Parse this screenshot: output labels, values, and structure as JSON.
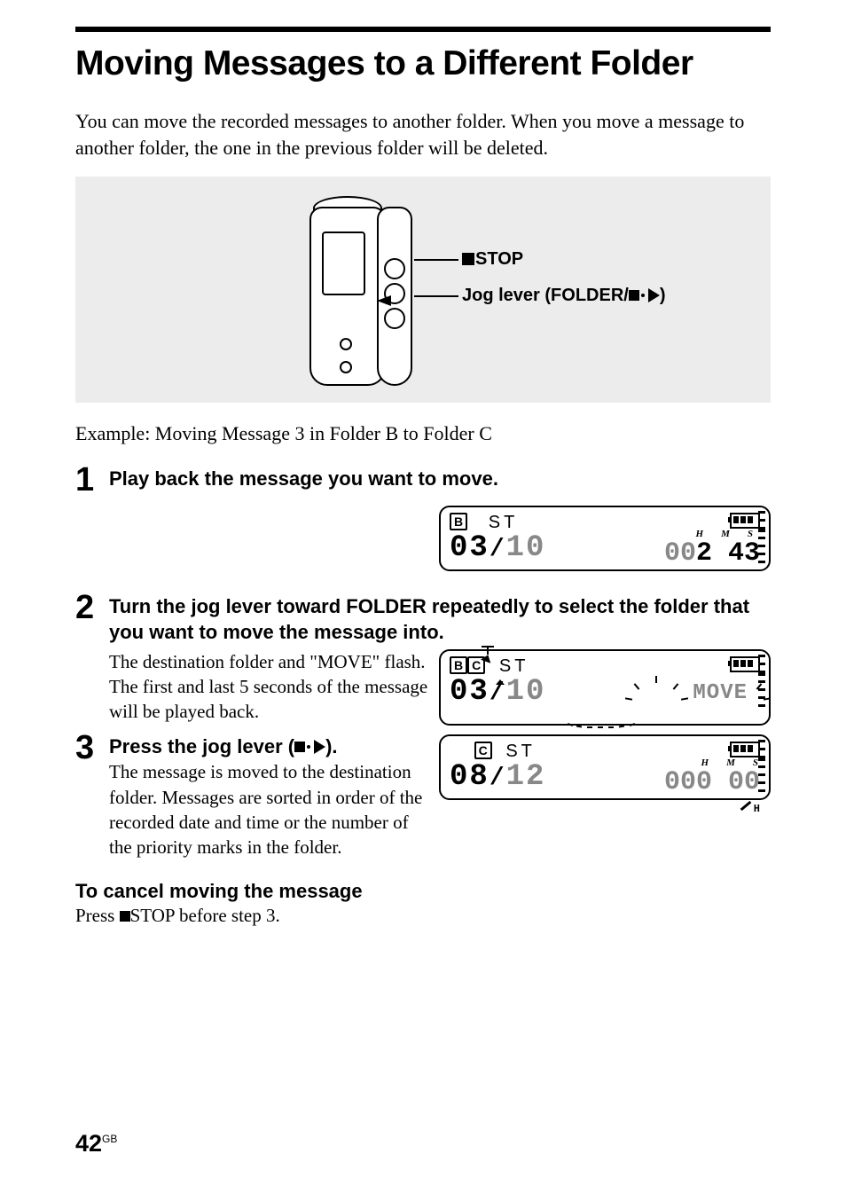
{
  "title": "Moving Messages to a Different Folder",
  "intro": "You can move the recorded messages to another folder. When you move a message to another folder, the one in the previous folder will be deleted.",
  "callouts": {
    "stop": "STOP",
    "jog": "Jog lever (FOLDER/"
  },
  "example": "Example: Moving Message 3 in Folder B to Folder C",
  "steps": {
    "s1_num": "1",
    "s1_head": "Play back the message you want to move.",
    "s2_num": "2",
    "s2_head": "Turn the jog lever toward FOLDER repeatedly to select the folder that you want to move the message into.",
    "s2_text": "The destination folder and \"MOVE\" flash.  The first and last 5 seconds of the message will be played back.",
    "s3_num": "3",
    "s3_head_a": "Press the jog lever (",
    "s3_head_b": ").",
    "s3_text": "The message is moved to the destination folder. Messages are sorted in order of the recorded date and time or the number of the priority marks in the folder."
  },
  "lcd": {
    "d1": {
      "folder": "B",
      "mode": "ST",
      "msg": "03",
      "total": "10",
      "time_h": "00",
      "time_m": "2",
      "time_s": "43",
      "h": "H",
      "m": "M",
      "s": "S"
    },
    "d2": {
      "folder_a": "B",
      "folder_b": "C",
      "mode": "ST",
      "msg": "03",
      "total": "10",
      "move": "MOVE"
    },
    "d3": {
      "folder": "C",
      "mode": "ST",
      "msg": "08",
      "total": "12",
      "time_h": "000",
      "time_m": "00",
      "h": "H",
      "m": "M",
      "s": "S",
      "icon": "H"
    }
  },
  "cancel_head": "To cancel moving the message",
  "cancel_text_a": "Press ",
  "cancel_text_b": "STOP before step 3.",
  "page_num": "42",
  "page_lang": "GB"
}
